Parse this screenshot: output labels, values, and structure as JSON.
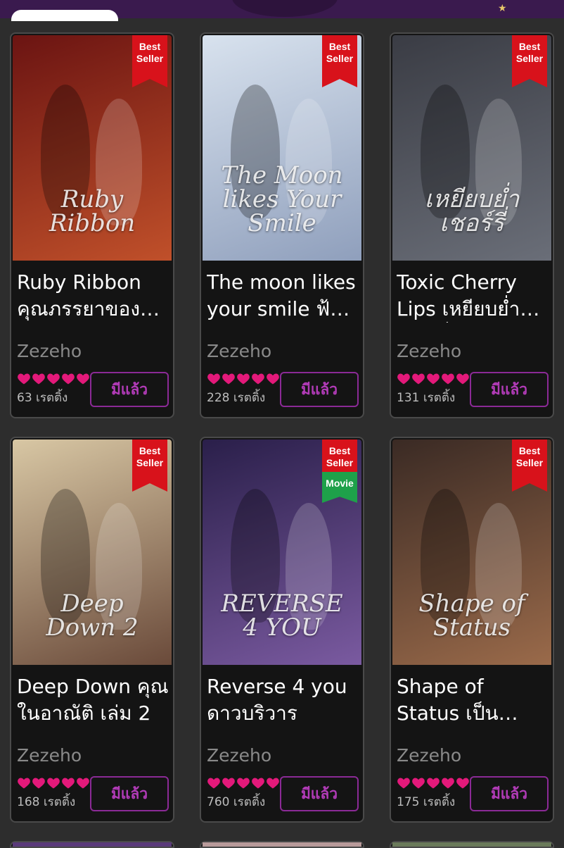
{
  "colors": {
    "background": "#2d2d2d",
    "card": "#141414",
    "best_seller_ribbon": "#d8121b",
    "movie_ribbon": "#1ea14a",
    "heart": "#e3197a",
    "owned_button": "#b23bb8"
  },
  "books": [
    {
      "title": "Ruby Ribbon คุณภรรยาของดารา",
      "author": "Zezeho",
      "rating_stars": 5,
      "ratings": "63 เรตติ้ง",
      "button": "มีแล้ว",
      "best_seller": "Best Seller",
      "cover_text": "Ruby\nRibbon",
      "cover_colors": [
        "#6b1412",
        "#c0502a"
      ]
    },
    {
      "title": "The moon likes your smile ฟ้องกล้ายเดือน",
      "author": "Zezeho",
      "rating_stars": 5,
      "ratings": "228 เรตติ้ง",
      "button": "มีแล้ว",
      "best_seller": "Best Seller",
      "cover_text": "The Moon\nlikes Your\nSmile",
      "cover_colors": [
        "#d8e2ee",
        "#8f9fbc"
      ]
    },
    {
      "title": "Toxic Cherry Lips เหยียบย่ำชั่วเชอร์รี่",
      "author": "Zezeho",
      "rating_stars": 5,
      "ratings": "131 เรตติ้ง",
      "button": "มีแล้ว",
      "best_seller": "Best Seller",
      "cover_text": "เหยียบย่ำ\nเชอร์รี่",
      "cover_colors": [
        "#3a3c44",
        "#6a6e78"
      ]
    },
    {
      "title": "Deep Down คุณในอาณัติ เล่ม 2",
      "author": "Zezeho",
      "rating_stars": 5,
      "ratings": "168 เรตติ้ง",
      "button": "มีแล้ว",
      "best_seller": "Best Seller",
      "cover_text": "Deep\nDown 2",
      "cover_colors": [
        "#d8c7a4",
        "#6a4a3a"
      ]
    },
    {
      "title": "Reverse 4 you ดาวบริวาร",
      "author": "Zezeho",
      "rating_stars": 5,
      "ratings": "760 เรตติ้ง",
      "button": "มีแล้ว",
      "best_seller": "Best Seller",
      "movie": "Movie",
      "cover_text": "REVERSE 4 YOU",
      "cover_colors": [
        "#2a1f4a",
        "#7a5aa0"
      ]
    },
    {
      "title": "Shape of Status เป็นสถานะ",
      "author": "Zezeho",
      "rating_stars": 5,
      "ratings": "175 เรตติ้ง",
      "button": "มีแล้ว",
      "best_seller": "Best Seller",
      "cover_text": "Shape of\nStatus",
      "cover_colors": [
        "#3a2a24",
        "#9a6a4a"
      ]
    }
  ]
}
